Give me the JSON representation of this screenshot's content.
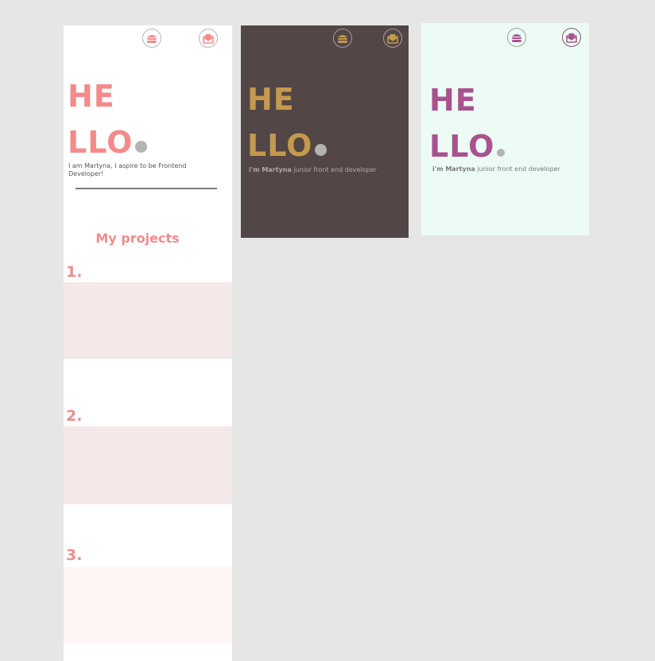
{
  "colors": {
    "canvas": "#e6e6e6",
    "pink_accent": "#f48a8a",
    "gold_accent": "#c49a4d",
    "purple_accent": "#a8528f",
    "dark_bg": "#534646",
    "mint_bg": "#ecfcf4",
    "card_bg": "#f4e9e8",
    "card_bg_light": "#fef6f5",
    "dot": "#b3b3b3"
  },
  "icons": [
    "burger-icon",
    "mail-icon"
  ],
  "frame_white": {
    "hello_line1": "HE",
    "hello_line2": "LLO",
    "intro": "I  am Martyna, I aspire to be Frontend Developer!",
    "projects_title": "My projects",
    "projects": [
      {
        "number": "1."
      },
      {
        "number": "2."
      },
      {
        "number": "3."
      }
    ]
  },
  "frame_dark": {
    "hello_line1": "HE",
    "hello_line2": "LLO",
    "tag_name": "i'm Martyna",
    "tag_role": "junior front end developer"
  },
  "frame_mint": {
    "hello_line1": "HE",
    "hello_line2": "LLO",
    "tag_name": "i'm Martyna",
    "tag_role": "junior front end developer"
  }
}
